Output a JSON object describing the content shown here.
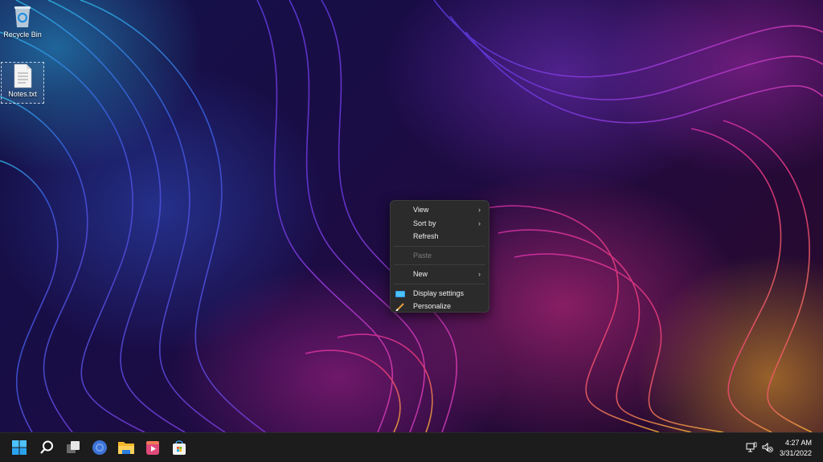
{
  "desktop": {
    "icons": [
      {
        "label": "Recycle Bin",
        "icon": "recycle-bin-icon",
        "selected": false
      },
      {
        "label": "Notes.txt",
        "icon": "text-file-icon",
        "selected": true
      }
    ]
  },
  "context_menu": {
    "items": [
      {
        "label": "View",
        "submenu": true,
        "enabled": true
      },
      {
        "label": "Sort by",
        "submenu": true,
        "enabled": true
      },
      {
        "label": "Refresh",
        "submenu": false,
        "enabled": true
      },
      {
        "label": "Paste",
        "submenu": false,
        "enabled": false
      },
      {
        "label": "New",
        "submenu": true,
        "enabled": true
      },
      {
        "label": "Display settings",
        "submenu": false,
        "enabled": true,
        "icon": "display-icon"
      },
      {
        "label": "Personalize",
        "submenu": false,
        "enabled": true,
        "icon": "paintbrush-icon"
      }
    ],
    "chevron": "›"
  },
  "taskbar": {
    "buttons": [
      {
        "name": "start",
        "icon": "windows-start-icon"
      },
      {
        "name": "search",
        "icon": "search-icon"
      },
      {
        "name": "task-view",
        "icon": "task-view-icon"
      },
      {
        "name": "browser",
        "icon": "chromium-browser-icon"
      },
      {
        "name": "file-explorer",
        "icon": "folder-icon"
      },
      {
        "name": "media-player",
        "icon": "media-player-icon"
      },
      {
        "name": "store",
        "icon": "store-icon"
      }
    ],
    "tray": {
      "network_icon": "network-icon",
      "volume_icon": "volume-muted-icon",
      "time": "4:27 AM",
      "date": "3/31/2022"
    }
  },
  "colors": {
    "taskbar_bg": "#1c1c1c",
    "menu_bg": "#2b2b2b",
    "accent_blue": "#4cc2ff"
  }
}
